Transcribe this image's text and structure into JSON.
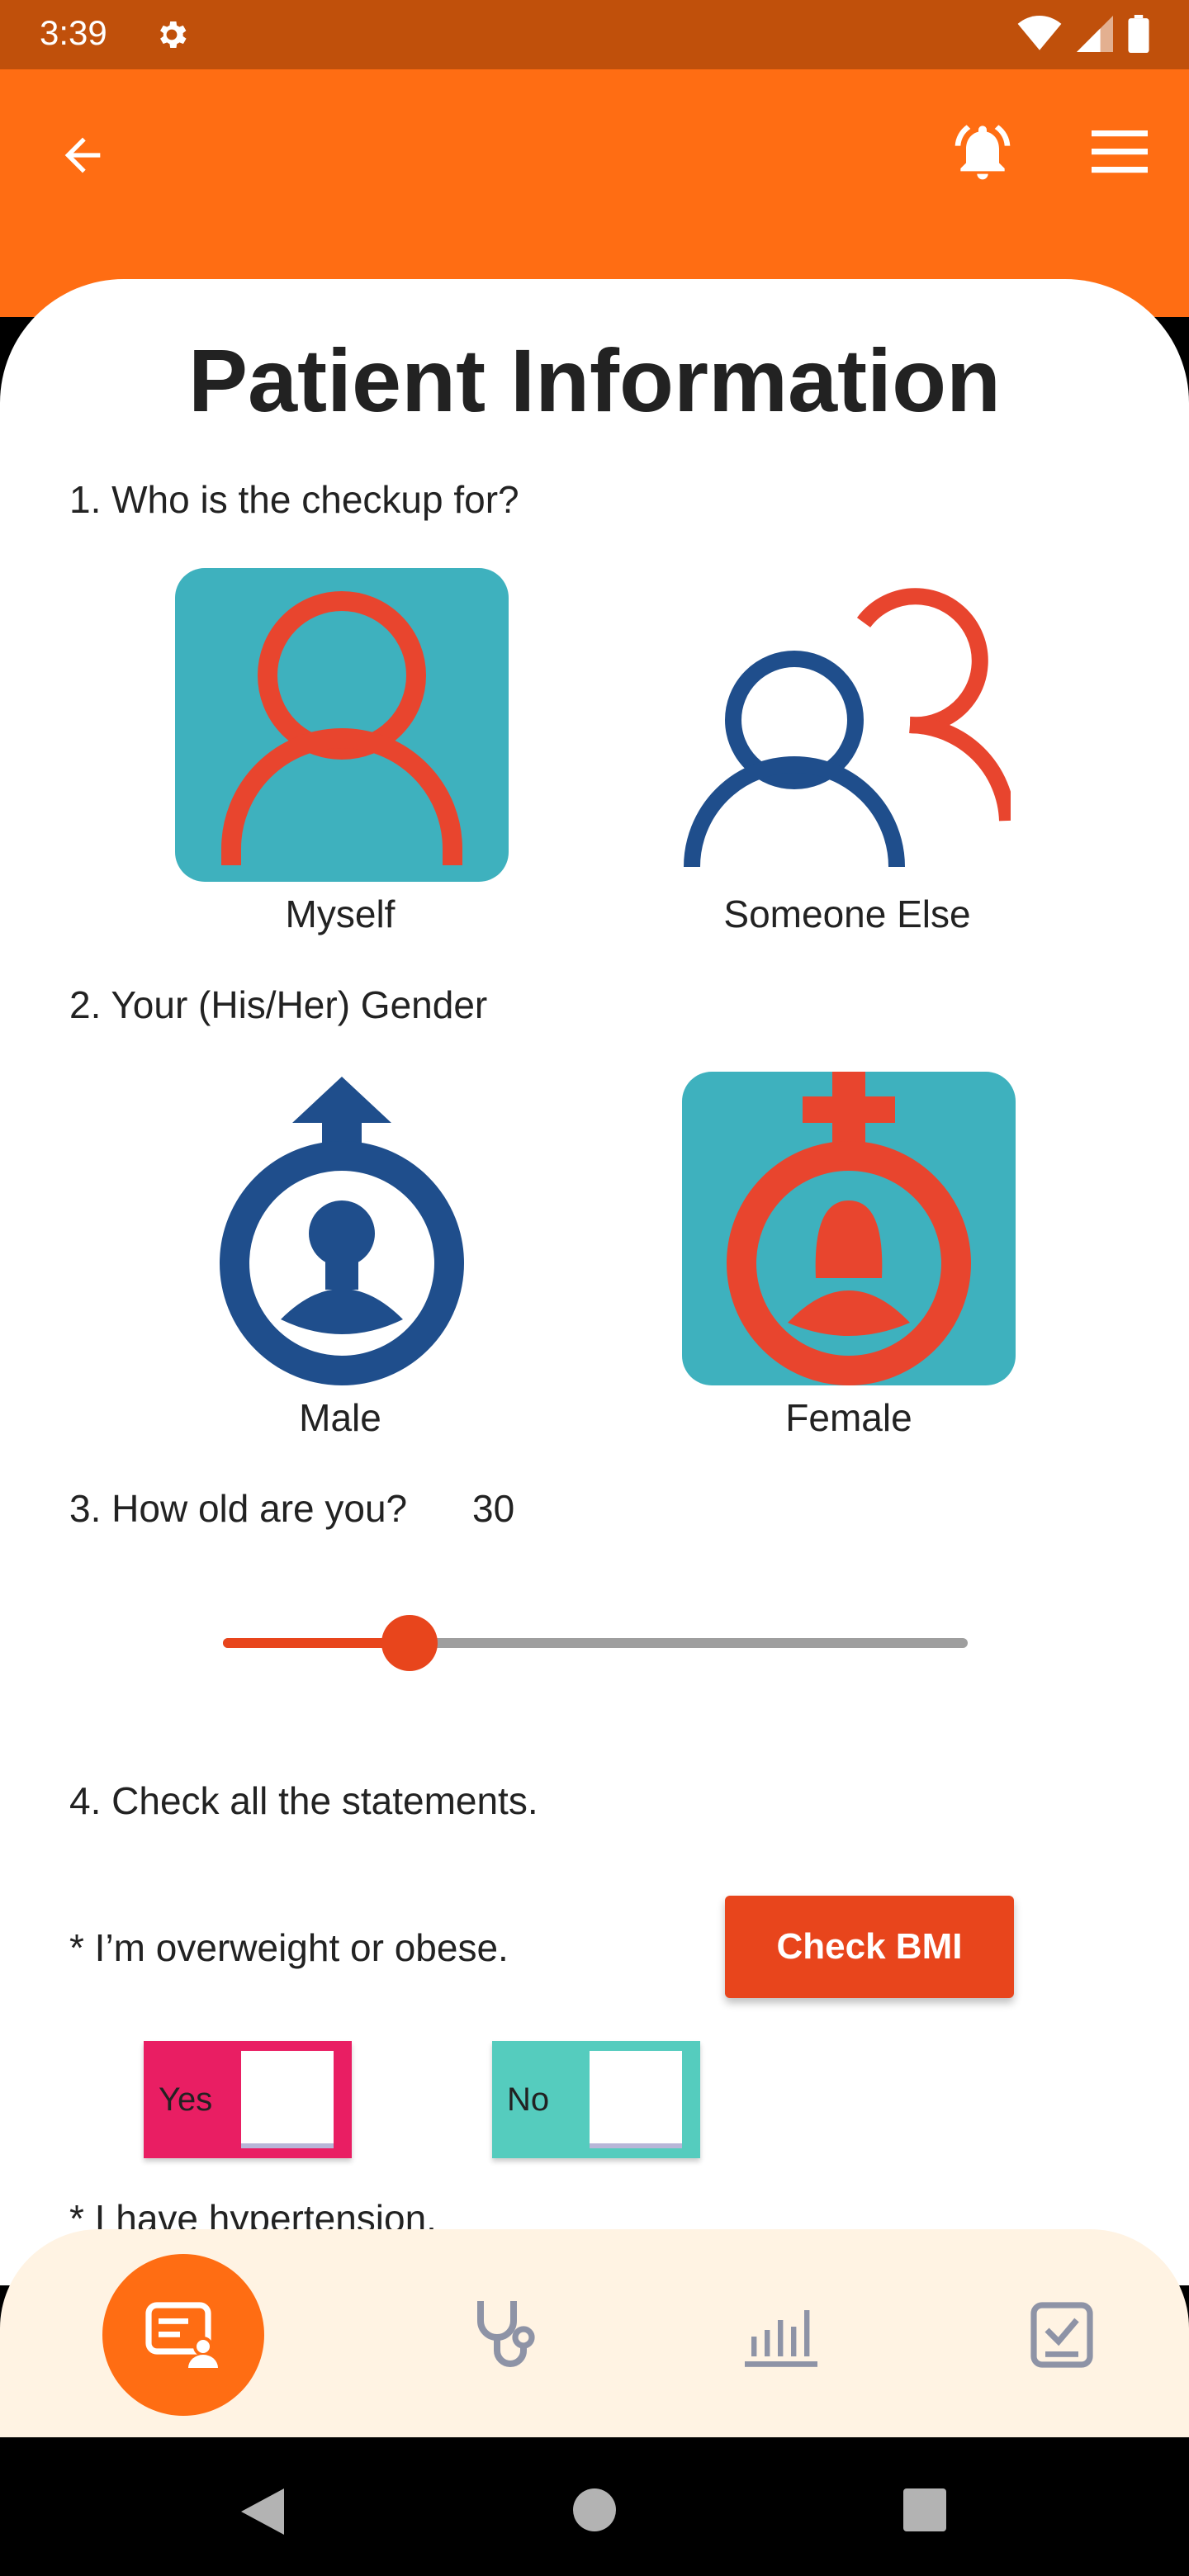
{
  "status_bar": {
    "time": "3:39"
  },
  "app": {
    "title": "Patient Information",
    "colors": {
      "primary": "#FF6D13",
      "status": "#C0500B",
      "accent": "#E8451C",
      "selected_bg": "#3EB1BE",
      "navy": "#1F4E8C"
    }
  },
  "questions": {
    "q1": {
      "label": "1. Who is the checkup for?",
      "options": [
        {
          "label": "Myself",
          "icon": "person-icon",
          "selected": true
        },
        {
          "label": "Someone Else",
          "icon": "two-people-icon",
          "selected": false
        }
      ]
    },
    "q2": {
      "label": "2. Your (His/Her) Gender",
      "options": [
        {
          "label": "Male",
          "icon": "male-icon",
          "selected": false
        },
        {
          "label": "Female",
          "icon": "female-icon",
          "selected": true
        }
      ]
    },
    "q3": {
      "label": "3. How old are you?",
      "value": "30",
      "slider_fraction": 0.25
    },
    "q4": {
      "label": "4. Check all the statements.",
      "statement1": "* I’m overweight or obese.",
      "bmi_button": "Check BMI",
      "yes_label": "Yes",
      "no_label": "No",
      "statement2": "* I have hypertension."
    }
  },
  "bottom_nav": [
    {
      "icon": "questionnaire-icon",
      "active": true
    },
    {
      "icon": "stethoscope-icon",
      "active": false
    },
    {
      "icon": "chart-icon",
      "active": false
    },
    {
      "icon": "checklist-icon",
      "active": false
    }
  ]
}
